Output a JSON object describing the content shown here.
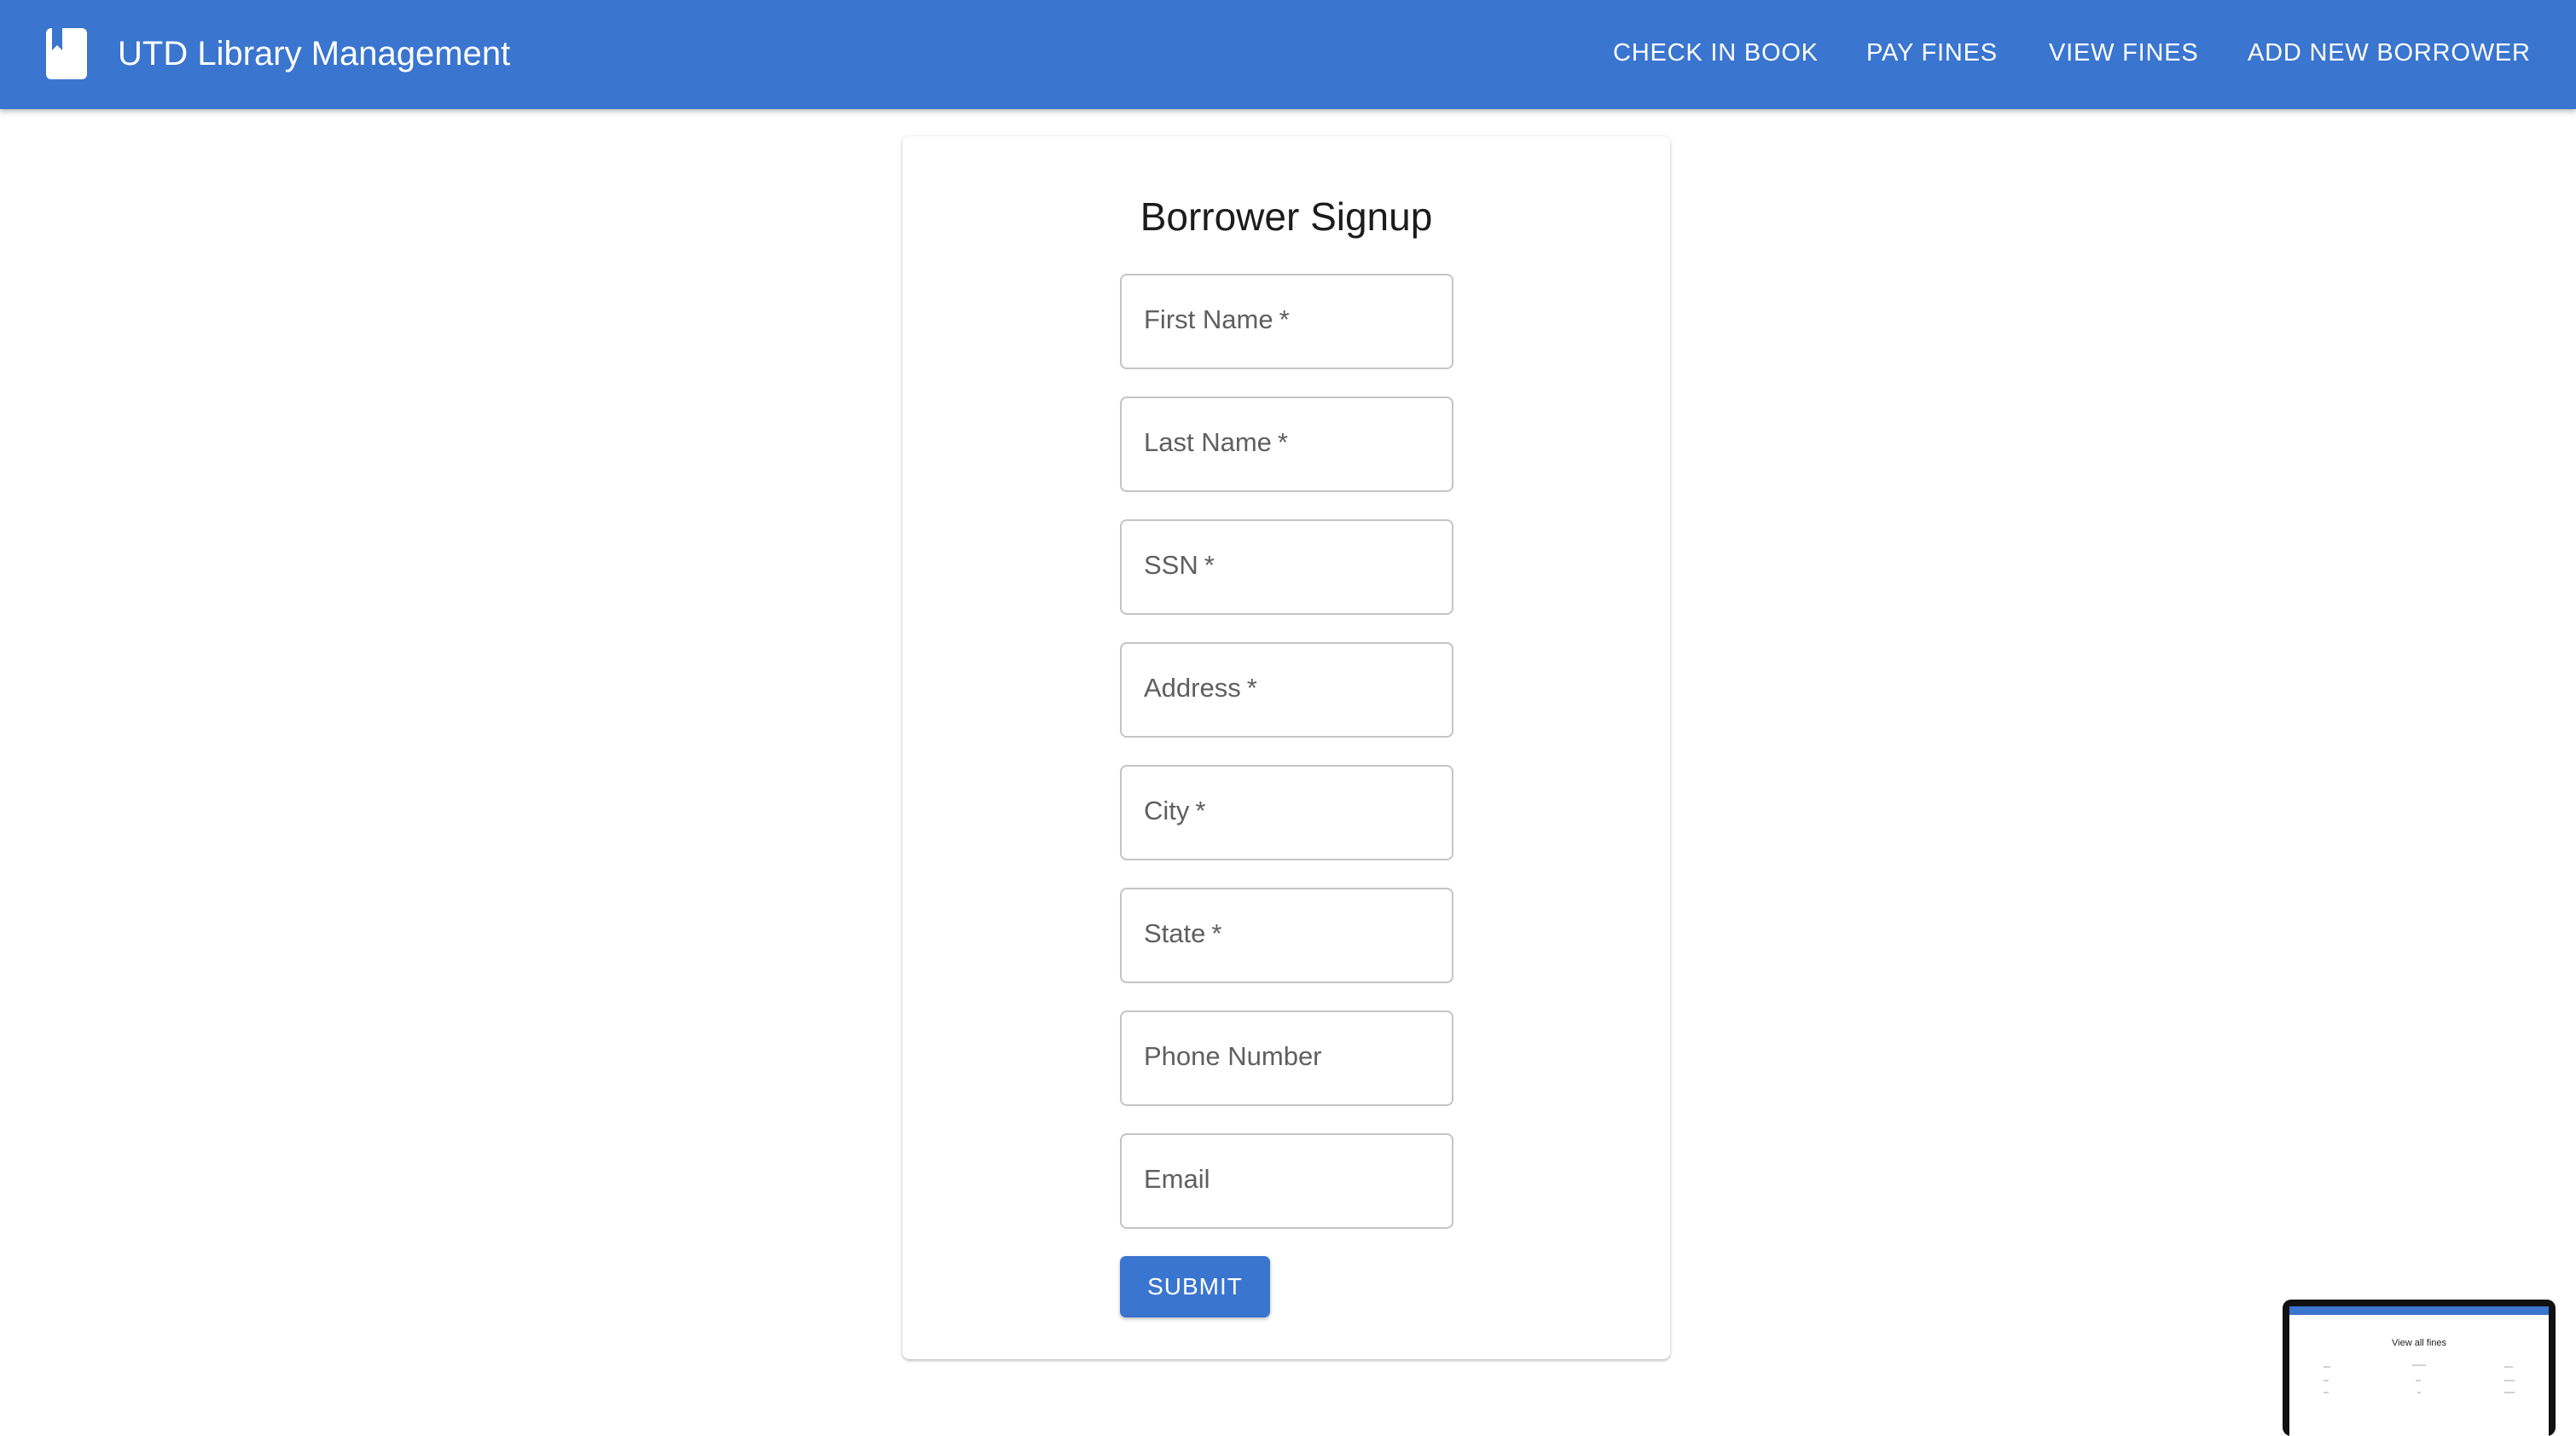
{
  "appbar": {
    "title": "UTD Library Management",
    "icon": "book-icon",
    "nav": [
      {
        "label": "CHECK IN BOOK"
      },
      {
        "label": "PAY FINES"
      },
      {
        "label": "VIEW FINES"
      },
      {
        "label": "ADD NEW BORROWER"
      }
    ]
  },
  "form": {
    "title": "Borrower Signup",
    "fields": [
      {
        "label": "First Name",
        "required_mark": "*",
        "value": ""
      },
      {
        "label": "Last Name",
        "required_mark": "*",
        "value": ""
      },
      {
        "label": "SSN",
        "required_mark": "*",
        "value": ""
      },
      {
        "label": "Address",
        "required_mark": "*",
        "value": ""
      },
      {
        "label": "City",
        "required_mark": "*",
        "value": ""
      },
      {
        "label": "State",
        "required_mark": "*",
        "value": ""
      },
      {
        "label": "Phone Number",
        "value": ""
      },
      {
        "label": "Email",
        "value": ""
      }
    ],
    "submit_label": "SUBMIT"
  },
  "preview_thumbnail": {
    "title": "View all fines"
  },
  "colors": {
    "primary": "#3a75cf",
    "background": "#ffffff",
    "field_border": "#c4c4c4",
    "label_text": "#5f5f5f"
  }
}
